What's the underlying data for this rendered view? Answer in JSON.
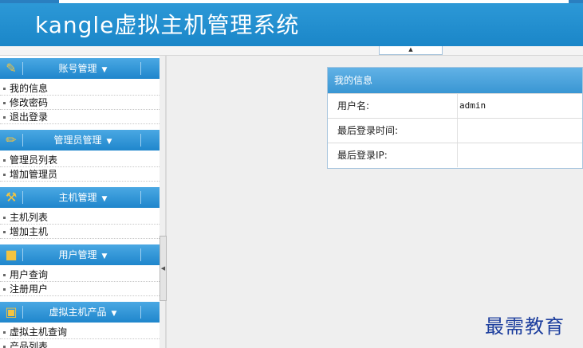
{
  "header": {
    "title": "kangle虚拟主机管理系统"
  },
  "sidebar": {
    "sections": [
      {
        "label": "账号管理",
        "icon": "ticket-icon",
        "items": [
          "我的信息",
          "修改密码",
          "退出登录"
        ]
      },
      {
        "label": "管理员管理",
        "icon": "edit-icon",
        "items": [
          "管理员列表",
          "增加管理员"
        ]
      },
      {
        "label": "主机管理",
        "icon": "tools-icon",
        "items": [
          "主机列表",
          "增加主机"
        ]
      },
      {
        "label": "用户管理",
        "icon": "folder-icon",
        "items": [
          "用户查询",
          "注册用户"
        ]
      },
      {
        "label": "虚拟主机产品",
        "icon": "monitor-icon",
        "items": [
          "虚拟主机查询",
          "产品列表"
        ]
      }
    ]
  },
  "info_panel": {
    "title": "我的信息",
    "rows": [
      {
        "key": "用户名:",
        "value": "admin"
      },
      {
        "key": "最后登录时间:",
        "value": ""
      },
      {
        "key": "最后登录IP:",
        "value": ""
      }
    ]
  },
  "watermark": "最需教育",
  "colors": {
    "header": "#1a86c8",
    "section_header": "#1f86cc",
    "panel_border": "#a9c6de",
    "watermark": "#1e3f9e"
  }
}
